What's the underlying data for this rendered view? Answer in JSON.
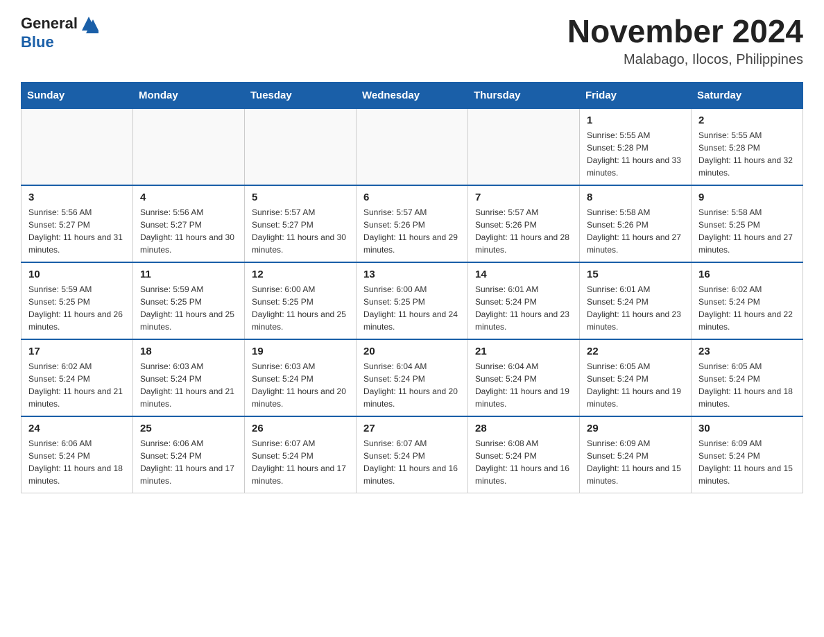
{
  "header": {
    "logo_general": "General",
    "logo_blue": "Blue",
    "main_title": "November 2024",
    "subtitle": "Malabago, Ilocos, Philippines"
  },
  "weekdays": [
    "Sunday",
    "Monday",
    "Tuesday",
    "Wednesday",
    "Thursday",
    "Friday",
    "Saturday"
  ],
  "weeks": [
    [
      {
        "day": "",
        "info": ""
      },
      {
        "day": "",
        "info": ""
      },
      {
        "day": "",
        "info": ""
      },
      {
        "day": "",
        "info": ""
      },
      {
        "day": "",
        "info": ""
      },
      {
        "day": "1",
        "info": "Sunrise: 5:55 AM\nSunset: 5:28 PM\nDaylight: 11 hours and 33 minutes."
      },
      {
        "day": "2",
        "info": "Sunrise: 5:55 AM\nSunset: 5:28 PM\nDaylight: 11 hours and 32 minutes."
      }
    ],
    [
      {
        "day": "3",
        "info": "Sunrise: 5:56 AM\nSunset: 5:27 PM\nDaylight: 11 hours and 31 minutes."
      },
      {
        "day": "4",
        "info": "Sunrise: 5:56 AM\nSunset: 5:27 PM\nDaylight: 11 hours and 30 minutes."
      },
      {
        "day": "5",
        "info": "Sunrise: 5:57 AM\nSunset: 5:27 PM\nDaylight: 11 hours and 30 minutes."
      },
      {
        "day": "6",
        "info": "Sunrise: 5:57 AM\nSunset: 5:26 PM\nDaylight: 11 hours and 29 minutes."
      },
      {
        "day": "7",
        "info": "Sunrise: 5:57 AM\nSunset: 5:26 PM\nDaylight: 11 hours and 28 minutes."
      },
      {
        "day": "8",
        "info": "Sunrise: 5:58 AM\nSunset: 5:26 PM\nDaylight: 11 hours and 27 minutes."
      },
      {
        "day": "9",
        "info": "Sunrise: 5:58 AM\nSunset: 5:25 PM\nDaylight: 11 hours and 27 minutes."
      }
    ],
    [
      {
        "day": "10",
        "info": "Sunrise: 5:59 AM\nSunset: 5:25 PM\nDaylight: 11 hours and 26 minutes."
      },
      {
        "day": "11",
        "info": "Sunrise: 5:59 AM\nSunset: 5:25 PM\nDaylight: 11 hours and 25 minutes."
      },
      {
        "day": "12",
        "info": "Sunrise: 6:00 AM\nSunset: 5:25 PM\nDaylight: 11 hours and 25 minutes."
      },
      {
        "day": "13",
        "info": "Sunrise: 6:00 AM\nSunset: 5:25 PM\nDaylight: 11 hours and 24 minutes."
      },
      {
        "day": "14",
        "info": "Sunrise: 6:01 AM\nSunset: 5:24 PM\nDaylight: 11 hours and 23 minutes."
      },
      {
        "day": "15",
        "info": "Sunrise: 6:01 AM\nSunset: 5:24 PM\nDaylight: 11 hours and 23 minutes."
      },
      {
        "day": "16",
        "info": "Sunrise: 6:02 AM\nSunset: 5:24 PM\nDaylight: 11 hours and 22 minutes."
      }
    ],
    [
      {
        "day": "17",
        "info": "Sunrise: 6:02 AM\nSunset: 5:24 PM\nDaylight: 11 hours and 21 minutes."
      },
      {
        "day": "18",
        "info": "Sunrise: 6:03 AM\nSunset: 5:24 PM\nDaylight: 11 hours and 21 minutes."
      },
      {
        "day": "19",
        "info": "Sunrise: 6:03 AM\nSunset: 5:24 PM\nDaylight: 11 hours and 20 minutes."
      },
      {
        "day": "20",
        "info": "Sunrise: 6:04 AM\nSunset: 5:24 PM\nDaylight: 11 hours and 20 minutes."
      },
      {
        "day": "21",
        "info": "Sunrise: 6:04 AM\nSunset: 5:24 PM\nDaylight: 11 hours and 19 minutes."
      },
      {
        "day": "22",
        "info": "Sunrise: 6:05 AM\nSunset: 5:24 PM\nDaylight: 11 hours and 19 minutes."
      },
      {
        "day": "23",
        "info": "Sunrise: 6:05 AM\nSunset: 5:24 PM\nDaylight: 11 hours and 18 minutes."
      }
    ],
    [
      {
        "day": "24",
        "info": "Sunrise: 6:06 AM\nSunset: 5:24 PM\nDaylight: 11 hours and 18 minutes."
      },
      {
        "day": "25",
        "info": "Sunrise: 6:06 AM\nSunset: 5:24 PM\nDaylight: 11 hours and 17 minutes."
      },
      {
        "day": "26",
        "info": "Sunrise: 6:07 AM\nSunset: 5:24 PM\nDaylight: 11 hours and 17 minutes."
      },
      {
        "day": "27",
        "info": "Sunrise: 6:07 AM\nSunset: 5:24 PM\nDaylight: 11 hours and 16 minutes."
      },
      {
        "day": "28",
        "info": "Sunrise: 6:08 AM\nSunset: 5:24 PM\nDaylight: 11 hours and 16 minutes."
      },
      {
        "day": "29",
        "info": "Sunrise: 6:09 AM\nSunset: 5:24 PM\nDaylight: 11 hours and 15 minutes."
      },
      {
        "day": "30",
        "info": "Sunrise: 6:09 AM\nSunset: 5:24 PM\nDaylight: 11 hours and 15 minutes."
      }
    ]
  ]
}
